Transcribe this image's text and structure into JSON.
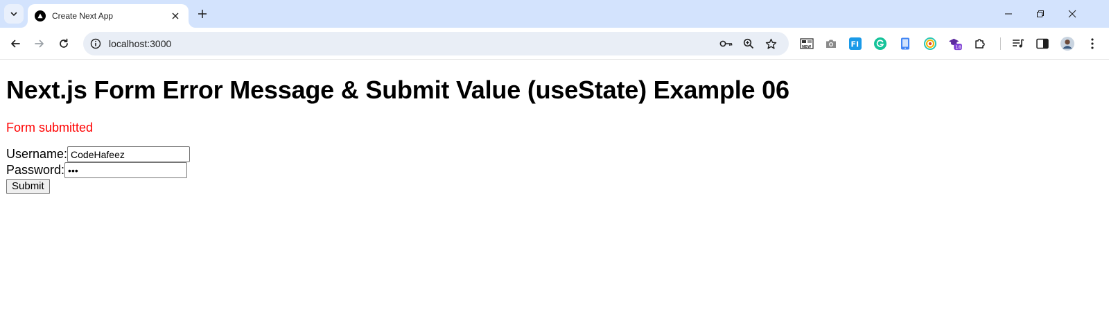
{
  "browser": {
    "tab": {
      "title": "Create Next App"
    },
    "address_bar": {
      "url": "localhost:3000"
    },
    "extensions": [
      {
        "icon": "news-extension-icon",
        "badge": ""
      },
      {
        "icon": "camera-extension-icon",
        "badge": ""
      },
      {
        "icon": "fi-extension-icon",
        "badge": ""
      },
      {
        "icon": "grammarly-extension-icon",
        "badge": ""
      },
      {
        "icon": "phone-extension-icon",
        "badge": ""
      },
      {
        "icon": "color-picker-extension-icon",
        "badge": ""
      },
      {
        "icon": "graduation-extension-icon",
        "badge": "18"
      }
    ],
    "colors": {
      "tabstrip": "#d3e3fd",
      "omnibox": "#e9eef6"
    }
  },
  "page": {
    "heading": "Next.js Form Error Message & Submit Value (useState) Example 06",
    "message": "Form submitted",
    "message_color": "#ff0000",
    "form": {
      "username_label": "Username:",
      "username_value": "CodeHafeez",
      "password_label": "Password:",
      "password_value": "abc",
      "submit_label": "Submit"
    }
  }
}
